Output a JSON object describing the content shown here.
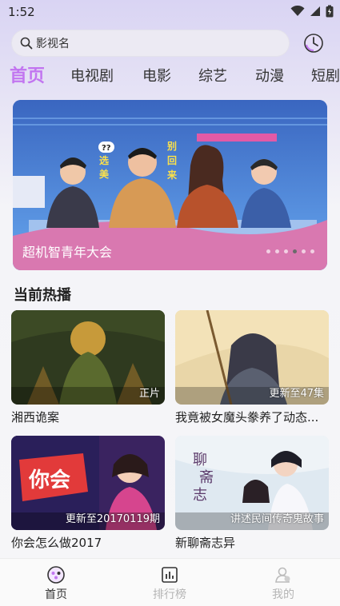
{
  "status": {
    "time": "1:52"
  },
  "search": {
    "placeholder": "影视名"
  },
  "tabs": [
    "首页",
    "电视剧",
    "电影",
    "综艺",
    "动漫",
    "短剧"
  ],
  "banner": {
    "caption": "超机智青年大会",
    "dots": 6,
    "active_dot": 4
  },
  "section": {
    "title": "当前热播"
  },
  "cards": [
    {
      "title": "湘西诡案",
      "badge": "正片"
    },
    {
      "title": "我竟被女魔头豢养了动态...",
      "badge": "更新至47集"
    },
    {
      "title": "你会怎么做2017",
      "badge": "更新至20170119期"
    },
    {
      "title": "新聊斋志异",
      "badge": "讲述民间传奇鬼故事"
    }
  ],
  "bottom_nav": [
    {
      "label": "首页",
      "icon": "home-icon"
    },
    {
      "label": "排行榜",
      "icon": "chart-icon"
    },
    {
      "label": "我的",
      "icon": "profile-icon"
    }
  ],
  "colors": {
    "accent": "#c276f0"
  }
}
